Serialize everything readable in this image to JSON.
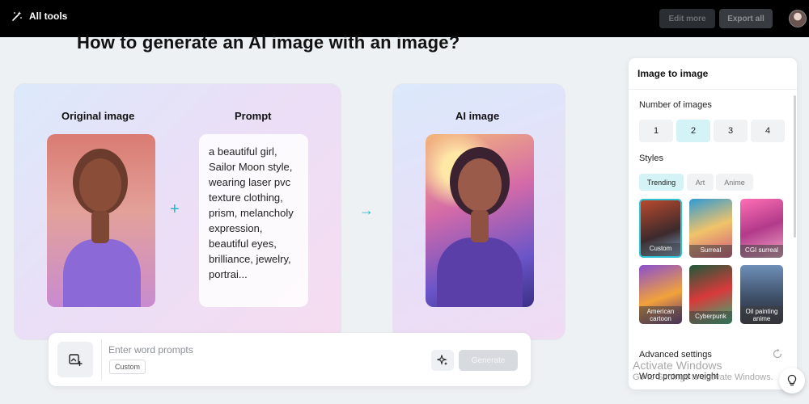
{
  "topbar": {
    "all_tools_label": "All tools",
    "edit_more_label": "Edit more",
    "export_all_label": "Export all"
  },
  "main": {
    "title": "How to generate an AI image with an image?",
    "original_label": "Original image",
    "prompt_label": "Prompt",
    "prompt_text": "a beautiful girl, Sailor Moon style, wearing laser pvc texture clothing, prism, melancholy expression, beautiful eyes, brilliance, jewelry, portrai...",
    "ai_label": "AI image"
  },
  "input_bar": {
    "placeholder": "Enter word prompts",
    "value": "",
    "chip_label": "Custom",
    "generate_label": "Generate"
  },
  "panel": {
    "title": "Image to image",
    "number_label": "Number of images",
    "numbers": [
      "1",
      "2",
      "3",
      "4"
    ],
    "selected_number": "2",
    "styles_label": "Styles",
    "style_tabs": [
      "Trending",
      "Art",
      "Anime"
    ],
    "selected_tab": "Trending",
    "style_tiles": [
      "Custom",
      "Surreal",
      "CGI surreal",
      "American cartoon",
      "Cyberpunk",
      "Oil painting anime"
    ],
    "selected_style": "Custom",
    "advanced_label": "Advanced settings",
    "word_weight_label": "Word prompt weight"
  },
  "watermark": {
    "line1": "Activate Windows",
    "line2": "Go to Settings to activate Windows."
  },
  "colors": {
    "accent": "#2fc2d3",
    "selected_bg": "#d3f3f6",
    "topbar_bg": "#000000"
  }
}
